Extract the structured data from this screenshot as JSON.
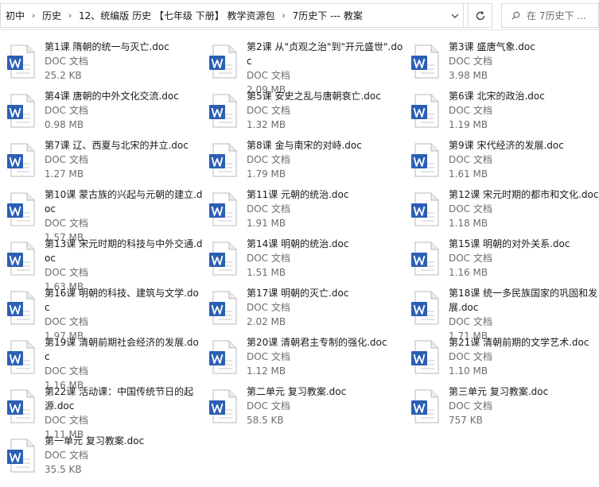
{
  "breadcrumb": [
    "初中",
    "历史",
    "12、统编版 历史 【七年级 下册】 教学资源包",
    "7历史下 --- 教案"
  ],
  "search": {
    "placeholder": "在 7历史下 ..."
  },
  "icons": {
    "file": "word-doc-icon",
    "refresh": "refresh-icon",
    "search": "search-icon",
    "dropdown": "chevron-down-icon"
  },
  "colors": {
    "word_blue": "#2b5fb4",
    "accent": "#3c82d8"
  },
  "files": [
    {
      "name": "第1课 隋朝的统一与灭亡.doc",
      "type": "DOC 文档",
      "size": "25.2 KB"
    },
    {
      "name": "第2课 从\"贞观之治\"到\"开元盛世\".doc",
      "type": "DOC 文档",
      "size": "2.09 MB"
    },
    {
      "name": "第3课 盛唐气象.doc",
      "type": "DOC 文档",
      "size": "3.98 MB"
    },
    {
      "name": "第4课 唐朝的中外文化交流.doc",
      "type": "DOC 文档",
      "size": "0.98 MB"
    },
    {
      "name": "第5课 安史之乱与唐朝衰亡.doc",
      "type": "DOC 文档",
      "size": "1.32 MB"
    },
    {
      "name": "第6课 北宋的政治.doc",
      "type": "DOC 文档",
      "size": "1.19 MB"
    },
    {
      "name": "第7课 辽、西夏与北宋的并立.doc",
      "type": "DOC 文档",
      "size": "1.27 MB"
    },
    {
      "name": "第8课 金与南宋的对峙.doc",
      "type": "DOC 文档",
      "size": "1.79 MB"
    },
    {
      "name": "第9课 宋代经济的发展.doc",
      "type": "DOC 文档",
      "size": "1.61 MB"
    },
    {
      "name": "第10课 蒙古族的兴起与元朝的建立.doc",
      "type": "DOC 文档",
      "size": "1.57 MB"
    },
    {
      "name": "第11课 元朝的统治.doc",
      "type": "DOC 文档",
      "size": "1.91 MB"
    },
    {
      "name": "第12课 宋元时期的都市和文化.doc",
      "type": "DOC 文档",
      "size": "1.18 MB"
    },
    {
      "name": "第13课 宋元时期的科技与中外交通.doc",
      "type": "DOC 文档",
      "size": "1.63 MB"
    },
    {
      "name": "第14课 明朝的统治.doc",
      "type": "DOC 文档",
      "size": "1.51 MB"
    },
    {
      "name": "第15课 明朝的对外关系.doc",
      "type": "DOC 文档",
      "size": "1.16 MB"
    },
    {
      "name": "第16课 明朝的科技、建筑与文学.doc",
      "type": "DOC 文档",
      "size": "1.97 MB"
    },
    {
      "name": "第17课 明朝的灭亡.doc",
      "type": "DOC 文档",
      "size": "2.02 MB"
    },
    {
      "name": "第18课 统一多民族国家的巩固和发展.doc",
      "type": "DOC 文档",
      "size": "1.71 MB"
    },
    {
      "name": "第19课 清朝前期社会经济的发展.doc",
      "type": "DOC 文档",
      "size": "1.16 MB"
    },
    {
      "name": "第20课 清朝君主专制的强化.doc",
      "type": "DOC 文档",
      "size": "1.12 MB"
    },
    {
      "name": "第21课 清朝前期的文学艺术.doc",
      "type": "DOC 文档",
      "size": "1.10 MB"
    },
    {
      "name": "第22课 活动课：中国传统节日的起源.doc",
      "type": "DOC 文档",
      "size": "1.11 MB"
    },
    {
      "name": "第二单元 复习教案.doc",
      "type": "DOC 文档",
      "size": "58.5 KB"
    },
    {
      "name": "第三单元 复习教案.doc",
      "type": "DOC 文档",
      "size": "757 KB"
    },
    {
      "name": "第一单元 复习教案.doc",
      "type": "DOC 文档",
      "size": "35.5 KB"
    }
  ]
}
